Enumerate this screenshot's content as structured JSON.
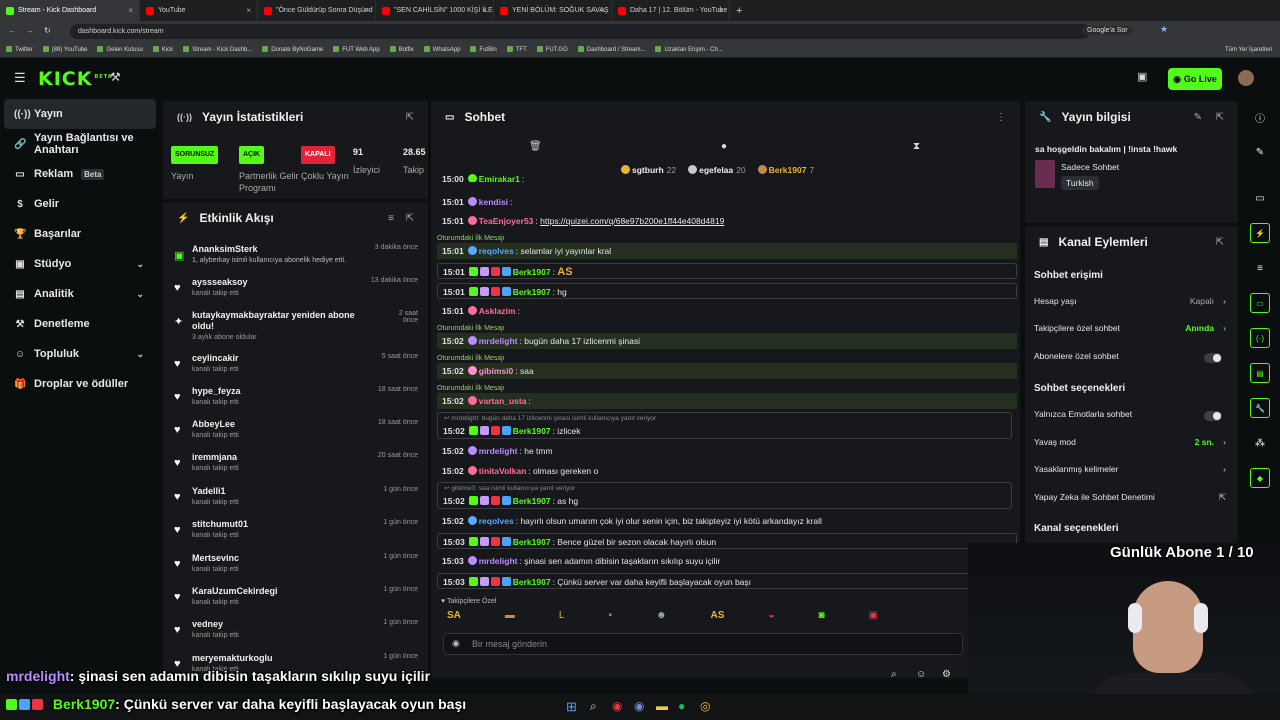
{
  "browser": {
    "tabs": [
      {
        "title": "Stream - Kick Dashboard",
        "color": "#53fc18",
        "active": true
      },
      {
        "title": "YouTube",
        "color": "#ff0000"
      },
      {
        "title": "\"Önce Güldürüp Sonra Düşünd",
        "color": "#ff0000"
      },
      {
        "title": "\"SEN CAHİLSİN\" 1000 KİŞİ İLE",
        "color": "#ff0000"
      },
      {
        "title": "YENİ BÖLÜM: SOĞUK SAVAŞ EI",
        "color": "#ff0000"
      },
      {
        "title": "Daha 17 | 12. Bölüm - YouTube",
        "color": "#ff0000"
      }
    ],
    "url": "dashboard.kick.com/stream",
    "google_btn": "Google'a Sor",
    "bookmarks": [
      "Twitter",
      "(88) YouTube",
      "Gelen Kutusu",
      "Kick",
      "Stream - Kick Dashb...",
      "Donate ByNoGame",
      "FUT Web App",
      "Botfix",
      "WhatsApp",
      "FutBin",
      "TFT",
      "FUT.GG",
      "Dashboard / Stream...",
      "Uzaktan Erişim - Ch..."
    ],
    "all_bookmarks": "Tüm Yer İşaretleri"
  },
  "header": {
    "logo": "KICK",
    "logo_sup": "BETA",
    "go_live": "Go Live",
    "accent": "#53fc18"
  },
  "sidebar": {
    "items": [
      {
        "label": "Yayın",
        "icon": "broadcast-icon",
        "glyph": "((·))",
        "active": true
      },
      {
        "label": "Yayın Bağlantısı ve Anahtarı",
        "icon": "link-icon",
        "glyph": "🔗"
      },
      {
        "label": "Reklam",
        "icon": "monitor-icon",
        "glyph": "▭",
        "badge": "Beta"
      },
      {
        "label": "Gelir",
        "icon": "dollar-icon",
        "glyph": "$"
      },
      {
        "label": "Başarılar",
        "icon": "trophy-icon",
        "glyph": "🏆"
      },
      {
        "label": "Stüdyo",
        "icon": "studio-icon",
        "glyph": "▣",
        "chevron": true
      },
      {
        "label": "Analitik",
        "icon": "analytics-icon",
        "glyph": "▤",
        "chevron": true
      },
      {
        "label": "Denetleme",
        "icon": "hammer-icon",
        "glyph": "⚒"
      },
      {
        "label": "Topluluk",
        "icon": "community-icon",
        "glyph": "☺",
        "chevron": true
      },
      {
        "label": "Droplar ve ödüller",
        "icon": "gift-icon",
        "glyph": "🎁"
      }
    ]
  },
  "stats": {
    "title": "Yayın İstatistikleri",
    "cols": [
      {
        "pill": "SORUNSUZ",
        "pill_bg": "#53fc18",
        "pill_fg": "#0b0e0f",
        "label": "Yayın"
      },
      {
        "pill": "AÇIK",
        "pill_bg": "#53fc18",
        "pill_fg": "#0b0e0f",
        "label": "Partnerlik Gelir Programı"
      },
      {
        "pill": "KAPALI",
        "pill_bg": "#e0243a",
        "pill_fg": "#ffffff",
        "label": "Çoklu Yayın"
      },
      {
        "pill": "91",
        "label": "İzleyici"
      },
      {
        "pill": "28.65",
        "label": "Takip"
      }
    ]
  },
  "activity": {
    "title": "Etkinlik Akışı",
    "items": [
      {
        "name": "AnanksimSterk",
        "sub": "1, alyberkay isimli kullanıcıya abonelik hediye etti.",
        "time": "3 dakika önce",
        "gift": true
      },
      {
        "name": "ayssseaksoy",
        "sub": "kanalı takip etti",
        "time": "13 dakika önce"
      },
      {
        "name": "kutaykaymakbayraktar yeniden abone oldu!",
        "sub": "3 aylık abone oldular",
        "time": "2 saat önce",
        "star": true
      },
      {
        "name": "ceylincakir",
        "sub": "kanalı takip etti",
        "time": "5 saat önce"
      },
      {
        "name": "hype_feyza",
        "sub": "kanalı takip etti",
        "time": "18 saat önce"
      },
      {
        "name": "AbbeyLee",
        "sub": "kanalı takip etti",
        "time": "18 saat önce"
      },
      {
        "name": "iremmjana",
        "sub": "kanalı takip etti",
        "time": "20 saat önce"
      },
      {
        "name": "Yadelli1",
        "sub": "kanalı takip etti",
        "time": "1 gün önce"
      },
      {
        "name": "stitchumut01",
        "sub": "kanalı takip etti",
        "time": "1 gün önce"
      },
      {
        "name": "Mertsevinc",
        "sub": "kanalı takip etti",
        "time": "1 gün önce"
      },
      {
        "name": "KaraUzumCekirdegi",
        "sub": "kanalı takip etti",
        "time": "1 gün önce"
      },
      {
        "name": "vedney",
        "sub": "kanalı takip etti",
        "time": "1 gün önce"
      },
      {
        "name": "meryemakturkoglu",
        "sub": "kanalı takip etti",
        "time": "1 gün önce"
      }
    ]
  },
  "chat": {
    "title": "Sohbet",
    "top_users": [
      {
        "name": "sgtburh",
        "count": "22",
        "color": "#e8b431"
      },
      {
        "name": "egefelaa",
        "count": "20",
        "color": "#c8c8c8"
      },
      {
        "name": "Berk1907",
        "count": "7",
        "color": "#c88a4a"
      }
    ],
    "first_message_label": "Oturumdaki İlk Mesajı",
    "messages": [
      {
        "time": "15:00",
        "user": "Emirakar1",
        "color": "#53fc18",
        "text": "",
        "partial": true
      },
      {
        "time": "15:01",
        "user": "kendisi",
        "color": "#b98cff",
        "text": ""
      },
      {
        "time": "15:01",
        "user": "TeaEnjoyer53",
        "color": "#ff6b9a",
        "text": "https://quizei.com/q/68e97b200e1ff44e408d4819",
        "link": true
      },
      {
        "time": "15:01",
        "user": "reqolves",
        "color": "#5aa8ff",
        "text": "selamlar iyi yayınlar kral",
        "first": true
      },
      {
        "time": "15:01",
        "user": "Berk1907",
        "color": "#53fc18",
        "text": "AS",
        "box": true
      },
      {
        "time": "15:01",
        "user": "Berk1907",
        "color": "#53fc18",
        "text": "hg",
        "box": true
      },
      {
        "time": "15:01",
        "user": "Asklazim",
        "color": "#ff6b9a",
        "text": ""
      },
      {
        "time": "15:02",
        "user": "mrdelight",
        "color": "#b98cff",
        "text": "bugün daha 17 izlicenmi şinasi",
        "first": true
      },
      {
        "time": "15:02",
        "user": "gibimsi0",
        "color": "#ff8fd0",
        "text": "saa",
        "first": true
      },
      {
        "time": "15:02",
        "user": "vartan_usta",
        "color": "#ff6b9a",
        "text": "",
        "first": true
      },
      {
        "time": "15:02",
        "user": "Berk1907",
        "color": "#53fc18",
        "text": "izlicek",
        "box": true,
        "reply": "mrdelight: bugün daha 17 izlicenmi şinasi isimli kullanıcıya yanıt veriyor"
      },
      {
        "time": "15:02",
        "user": "mrdelight",
        "color": "#b98cff",
        "text": "he tmm"
      },
      {
        "time": "15:02",
        "user": "tinitaVolkan",
        "color": "#ff6b9a",
        "text": "olması gereken o"
      },
      {
        "time": "15:02",
        "user": "Berk1907",
        "color": "#53fc18",
        "text": "as hg",
        "box": true,
        "reply": "gibimsi0: saa isimli kullanıcıya yanıt veriyor"
      },
      {
        "time": "15:02",
        "user": "reqolves",
        "color": "#5aa8ff",
        "text": "hayırlı olsun umarım çok iyi olur senin için, biz takipteyiz iyi kötü arkandayız krall"
      },
      {
        "time": "15:03",
        "user": "Berk1907",
        "color": "#53fc18",
        "text": "Bence güzel bir sezon olacak hayırlı olsun",
        "box": true
      },
      {
        "time": "15:03",
        "user": "mrdelight",
        "color": "#b98cff",
        "text": "şinasi sen adamın dibisin taşakların sıkılıp suyu içilir"
      },
      {
        "time": "15:03",
        "user": "Berk1907",
        "color": "#53fc18",
        "text": "Çünkü server var daha keyifli başlayacak oyun başı",
        "box": true
      }
    ],
    "followers_only": "Takipçilere Özel",
    "input_placeholder": "Bir mesaj gönderin"
  },
  "stream_info": {
    "title": "Yayın bilgisi",
    "stream_title": "sa hoşgeldin bakalım | !insta !hawk",
    "category": "Sadece Sohbet",
    "language": "Turkish"
  },
  "channel_actions": {
    "title": "Kanal Eylemleri",
    "chat_access": "Sohbet erişimi",
    "account_age": "Hesap yaşı",
    "account_age_val": "Kapalı",
    "followers_chat": "Takipçilere özel sohbet",
    "followers_chat_val": "Anında",
    "subs_chat": "Abonelere özel sohbet",
    "chat_options": "Sohbet seçenekleri",
    "emote_only": "Yalnızca Emotlarla sohbet",
    "slow_mode": "Yavaş mod",
    "slow_mode_val": "2 sn.",
    "banned_words": "Yasaklanmış kelimeler",
    "ai_moderation": "Yapay Zeka ile Sohbet Denetimi",
    "channel_options": "Kanal seçenekleri"
  },
  "overlay": {
    "sub_goal": "Günlük Abone 1 / 10",
    "chat_line1_user": "mrdelight",
    "chat_line1_text": ": şinasi sen adamın dibisin taşakların sıkılıp suyu içilir",
    "chat_line2_user": "Berk1907",
    "chat_line2_text": ": Çünkü server var daha keyifli başlayacak oyun başı"
  }
}
